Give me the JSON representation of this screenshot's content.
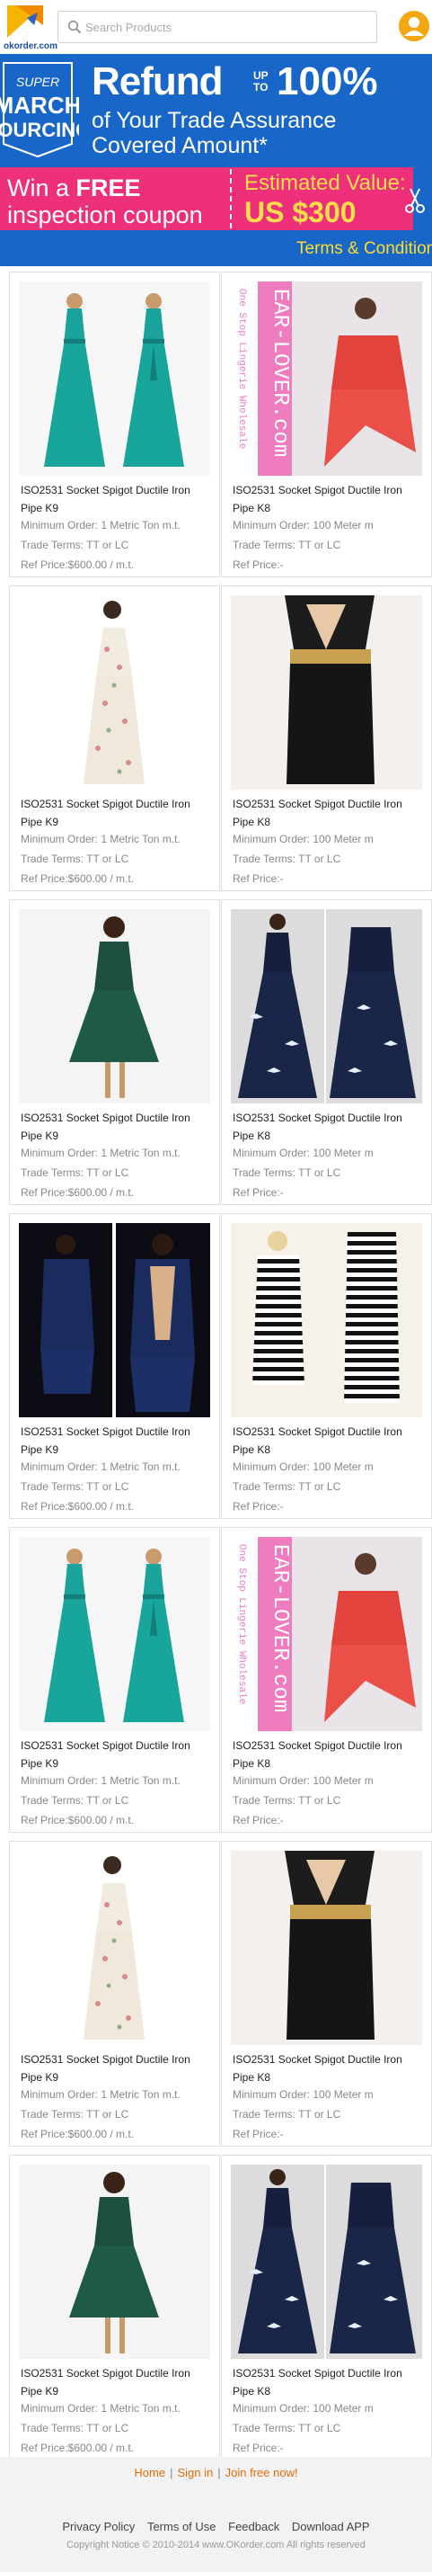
{
  "header": {
    "logo_text": "okorder.com",
    "search_placeholder": "Search Products"
  },
  "banner": {
    "badge_line1": "SUPER",
    "badge_line2": "MARCH",
    "badge_line3": "SOURCING",
    "refund": "Refund",
    "upto": "UP TO",
    "percent": "100%",
    "line1": "of Your Trade Assurance",
    "line2": "Covered Amount*",
    "win_pre": "Win a ",
    "win_free": "FREE",
    "win_line2": "inspection coupon",
    "estimated": "Estimated Value:",
    "value": "US $300",
    "terms": "Terms & Conditions"
  },
  "products": [
    {
      "title": "ISO2531 Socket Spigot Ductile Iron Pipe K9",
      "min_order": "Minimum Order: 1 Metric Ton m.t.",
      "trade": "Trade Terms:  TT or LC",
      "price": "Ref Price:$600.00 / m.t."
    },
    {
      "title": "ISO2531 Socket Spigot Ductile Iron Pipe K8",
      "min_order": "Minimum Order: 100 Meter m",
      "trade": "Trade Terms:  TT or LC",
      "price": "Ref Price:-",
      "image_text": "EAR-LOVER.com",
      "image_side_text": "One Stop Lingerie Wholesale"
    },
    {
      "title": "ISO2531 Socket Spigot Ductile Iron Pipe K9",
      "min_order": "Minimum Order: 1 Metric Ton m.t.",
      "trade": "Trade Terms:  TT or LC",
      "price": "Ref Price:$600.00 / m.t."
    },
    {
      "title": "ISO2531 Socket Spigot Ductile Iron Pipe K8",
      "min_order": "Minimum Order: 100 Meter m",
      "trade": "Trade Terms:  TT or LC",
      "price": "Ref Price:-"
    },
    {
      "title": "ISO2531 Socket Spigot Ductile Iron Pipe K9",
      "min_order": "Minimum Order: 1 Metric Ton m.t.",
      "trade": "Trade Terms:  TT or LC",
      "price": "Ref Price:$600.00 / m.t."
    },
    {
      "title": "ISO2531 Socket Spigot Ductile Iron Pipe K8",
      "min_order": "Minimum Order: 100 Meter m",
      "trade": "Trade Terms:  TT or LC",
      "price": "Ref Price:-"
    },
    {
      "title": "ISO2531 Socket Spigot Ductile Iron Pipe K9",
      "min_order": "Minimum Order: 1 Metric Ton m.t.",
      "trade": "Trade Terms:  TT or LC",
      "price": "Ref Price:$600.00 / m.t."
    },
    {
      "title": "ISO2531 Socket Spigot Ductile Iron Pipe K8",
      "min_order": "Minimum Order: 100 Meter m",
      "trade": "Trade Terms:  TT or LC",
      "price": "Ref Price:-"
    },
    {
      "title": "ISO2531 Socket Spigot Ductile Iron Pipe K9",
      "min_order": "Minimum Order: 1 Metric Ton m.t.",
      "trade": "Trade Terms:  TT or LC",
      "price": "Ref Price:$600.00 / m.t."
    },
    {
      "title": "ISO2531 Socket Spigot Ductile Iron Pipe K8",
      "min_order": "Minimum Order: 100 Meter m",
      "trade": "Trade Terms:  TT or LC",
      "price": "Ref Price:-",
      "image_text": "EAR-LOVER.com",
      "image_side_text": "One Stop Lingerie Wholesale"
    },
    {
      "title": "ISO2531 Socket Spigot Ductile Iron Pipe K9",
      "min_order": "Minimum Order: 1 Metric Ton m.t.",
      "trade": "Trade Terms:  TT or LC",
      "price": "Ref Price:$600.00 / m.t."
    },
    {
      "title": "ISO2531 Socket Spigot Ductile Iron Pipe K8",
      "min_order": "Minimum Order: 100 Meter m",
      "trade": "Trade Terms:  TT or LC",
      "price": "Ref Price:-"
    },
    {
      "title": "ISO2531 Socket Spigot Ductile Iron Pipe K9",
      "min_order": "Minimum Order: 1 Metric Ton m.t.",
      "trade": "Trade Terms:  TT or LC",
      "price": "Ref Price:$600.00 / m.t."
    },
    {
      "title": "ISO2531 Socket Spigot Ductile Iron Pipe K8",
      "min_order": "Minimum Order: 100 Meter m",
      "trade": "Trade Terms:  TT or LC",
      "price": "Ref Price:-"
    }
  ],
  "footer": {
    "home": "Home",
    "signin": "Sign in",
    "join": "Join free now!",
    "privacy": "Privacy Policy",
    "terms": "Terms of Use",
    "feedback": "Feedback",
    "download": "Download APP",
    "copyright": "Copyright Notice © 2010-2014    www.OKorder.com All rights reserved"
  },
  "colors": {
    "banner_blue": "#1766c8",
    "coupon_pink": "#ee2f79",
    "yellow": "#ffe04a",
    "footer_link": "#e36c0a"
  }
}
